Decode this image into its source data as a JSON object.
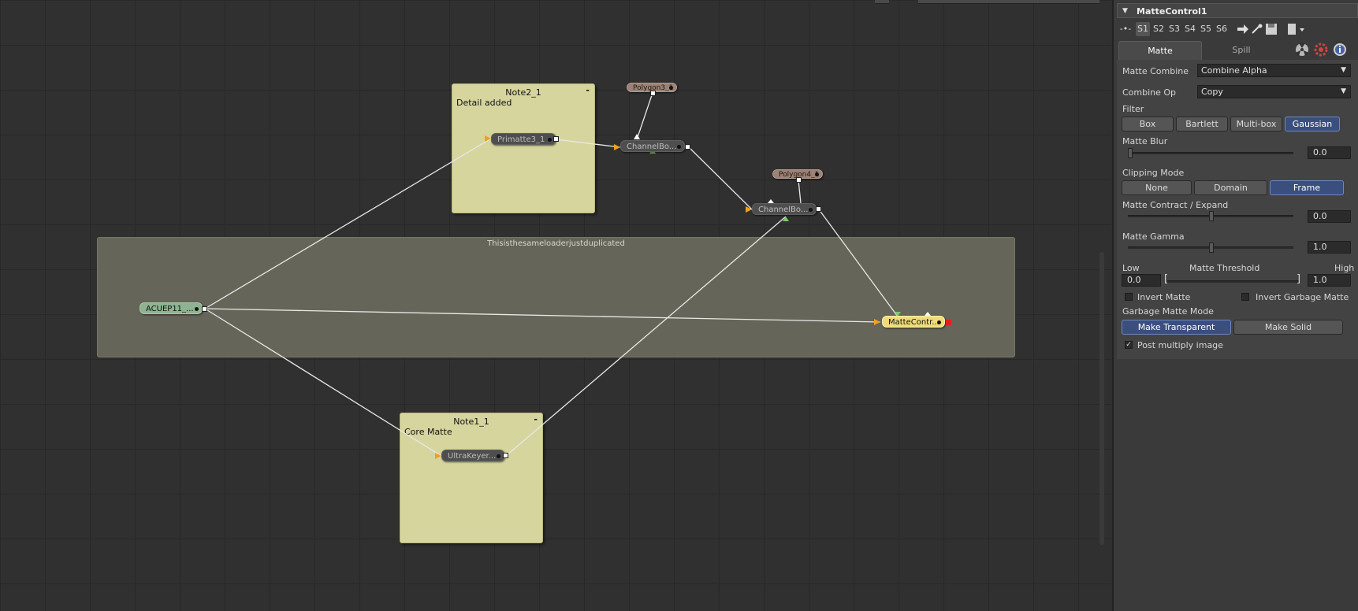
{
  "flow": {
    "underlay_title": "Thisisthesameloaderjustduplicated",
    "notes": [
      {
        "title": "Note2_1",
        "body": "Detail added",
        "minimize": "-"
      },
      {
        "title": "Note1_1",
        "body": "Core Matte",
        "minimize": "-"
      }
    ],
    "nodes": {
      "primatte": "Primatte3_1",
      "channelbool1": "ChannelBo...",
      "channelbool2": "ChannelBo...",
      "polygon3": "Polygon3_1",
      "polygon4": "Polygon4_1",
      "loader": "ACUEP11_...",
      "mattecontrol": "MatteContr...",
      "ultrakeyer": "UltraKeyer..."
    }
  },
  "inspector": {
    "tool_name": "MatteControl1",
    "toolbar": {
      "pin_icon": "-•-",
      "slots": [
        "S1",
        "S2",
        "S3",
        "S4",
        "S5",
        "S6"
      ],
      "selected_slot": "S1"
    },
    "tabs": [
      "Matte",
      "Spill"
    ],
    "active_tab": "Matte",
    "matte_combine": {
      "label": "Matte Combine",
      "value": "Combine Alpha"
    },
    "combine_op": {
      "label": "Combine Op",
      "value": "Copy"
    },
    "filter": {
      "label": "Filter",
      "options": [
        "Box",
        "Bartlett",
        "Multi-box",
        "Gaussian"
      ],
      "selected": "Gaussian"
    },
    "matte_blur": {
      "label": "Matte Blur",
      "value": "0.0"
    },
    "clipping_mode": {
      "label": "Clipping Mode",
      "options": [
        "None",
        "Domain",
        "Frame"
      ],
      "selected": "Frame"
    },
    "matte_contract_expand": {
      "label": "Matte Contract / Expand",
      "value": "0.0"
    },
    "matte_gamma": {
      "label": "Matte Gamma",
      "value": "1.0"
    },
    "matte_threshold": {
      "label": "Matte Threshold",
      "low_label": "Low",
      "high_label": "High",
      "low": "0.0",
      "high": "1.0"
    },
    "invert_matte": {
      "label": "Invert Matte",
      "checked": false
    },
    "invert_garbage_matte": {
      "label": "Invert Garbage Matte",
      "checked": false
    },
    "garbage_matte_mode": {
      "label": "Garbage Matte Mode",
      "options": [
        "Make Transparent",
        "Make Solid"
      ],
      "selected": "Make Transparent"
    },
    "post_multiply": {
      "label": "Post multiply image",
      "checked": true,
      "checkmark": "✓"
    }
  }
}
